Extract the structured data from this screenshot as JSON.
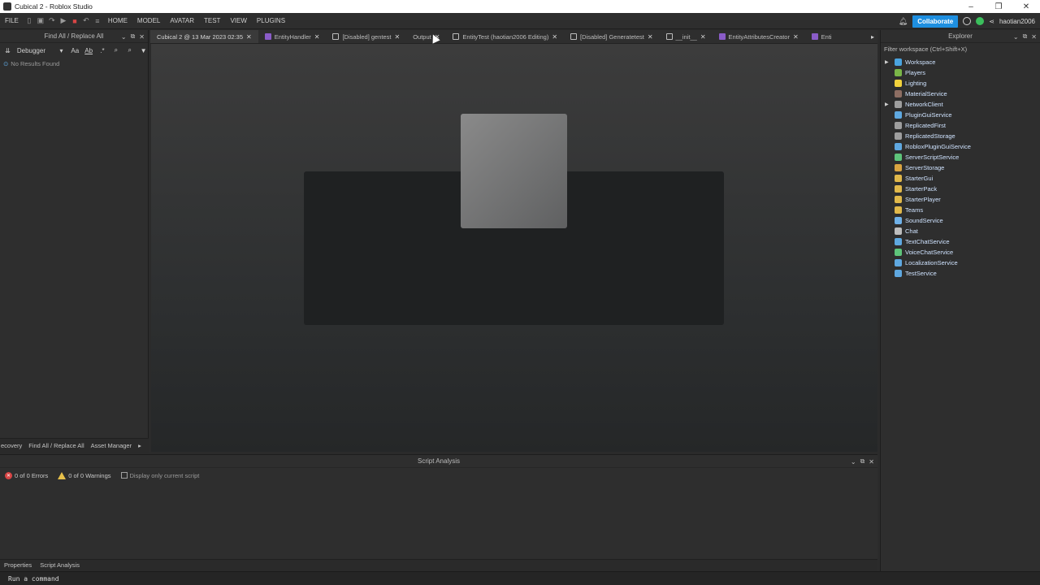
{
  "window": {
    "title": "Cubical 2 - Roblox Studio"
  },
  "menu": {
    "file": "FILE",
    "items": [
      "HOME",
      "MODEL",
      "AVATAR",
      "TEST",
      "VIEW",
      "PLUGINS"
    ]
  },
  "topbar": {
    "collaborate": "Collaborate",
    "username": "haotian2006"
  },
  "find_panel": {
    "title": "Find All / Replace All",
    "scope": "Debugger",
    "toggle_case": "Aa",
    "toggle_word": "Ab",
    "no_results": "No Results Found",
    "bottom_tabs": [
      "ecovery",
      "Find All / Replace All",
      "Asset Manager"
    ]
  },
  "doc_tabs": [
    {
      "label": "Cubical 2 @ 13 Mar 2023 02:35",
      "icon": "none",
      "active": true
    },
    {
      "label": "EntityHandler",
      "icon": "module-script-icon"
    },
    {
      "label": "[Disabled] gentest",
      "icon": "script-icon"
    },
    {
      "label": "Output",
      "icon": "none"
    },
    {
      "label": "EntityTest (haotian2006 Editing)",
      "icon": "script-icon"
    },
    {
      "label": "[Disabled] Generatetest",
      "icon": "script-icon"
    },
    {
      "label": "__init__",
      "icon": "script-icon"
    },
    {
      "label": "EntityAttributesCreator",
      "icon": "module-script-icon"
    },
    {
      "label": "Enti",
      "icon": "module-script-icon"
    }
  ],
  "script_analysis": {
    "title": "Script Analysis",
    "errors": "0 of 0 Errors",
    "warnings": "0 of 0 Warnings",
    "display_current": "Display only current script",
    "bottom_tabs": [
      "Properties",
      "Script Analysis"
    ]
  },
  "command_bar": {
    "placeholder": "Run a command"
  },
  "explorer": {
    "title": "Explorer",
    "filter": "Filter workspace (Ctrl+Shift+X)",
    "items": [
      {
        "label": "Workspace",
        "expandable": true,
        "color": "#4aa3df"
      },
      {
        "label": "Players",
        "expandable": false,
        "color": "#7ab648"
      },
      {
        "label": "Lighting",
        "expandable": false,
        "color": "#f2d23c"
      },
      {
        "label": "MaterialService",
        "expandable": false,
        "color": "#8d6e63"
      },
      {
        "label": "NetworkClient",
        "expandable": true,
        "color": "#9e9e9e"
      },
      {
        "label": "PluginGuiService",
        "expandable": false,
        "color": "#5fa8e0"
      },
      {
        "label": "ReplicatedFirst",
        "expandable": false,
        "color": "#9e9e9e"
      },
      {
        "label": "ReplicatedStorage",
        "expandable": false,
        "color": "#9e9e9e"
      },
      {
        "label": "RobloxPluginGuiService",
        "expandable": false,
        "color": "#5fa8e0"
      },
      {
        "label": "ServerScriptService",
        "expandable": false,
        "color": "#5ec47a"
      },
      {
        "label": "ServerStorage",
        "expandable": false,
        "color": "#d9a441"
      },
      {
        "label": "StarterGui",
        "expandable": false,
        "color": "#e0b84a"
      },
      {
        "label": "StarterPack",
        "expandable": false,
        "color": "#e0b84a"
      },
      {
        "label": "StarterPlayer",
        "expandable": false,
        "color": "#e0b84a"
      },
      {
        "label": "Teams",
        "expandable": false,
        "color": "#e0b84a"
      },
      {
        "label": "SoundService",
        "expandable": false,
        "color": "#6fb1e8"
      },
      {
        "label": "Chat",
        "expandable": false,
        "color": "#bdbdbd"
      },
      {
        "label": "TextChatService",
        "expandable": false,
        "color": "#5fa8e0"
      },
      {
        "label": "VoiceChatService",
        "expandable": false,
        "color": "#5ec47a"
      },
      {
        "label": "LocalizationService",
        "expandable": false,
        "color": "#5fa8e0"
      },
      {
        "label": "TestService",
        "expandable": false,
        "color": "#5fa8e0"
      }
    ]
  }
}
